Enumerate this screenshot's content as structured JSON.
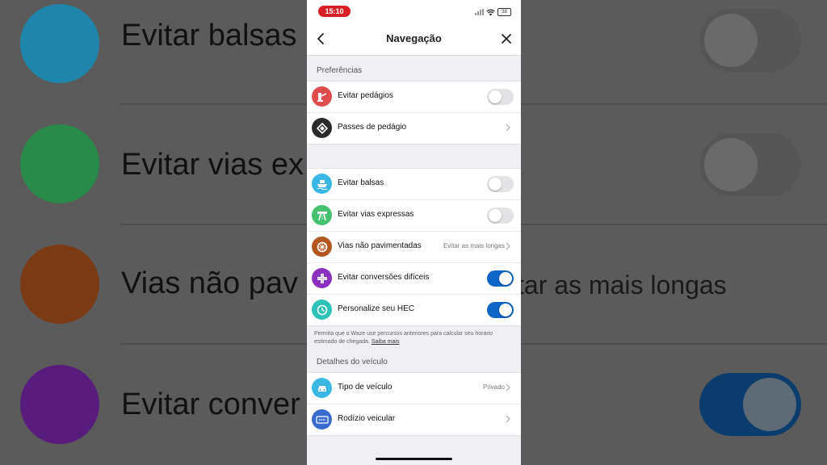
{
  "background": {
    "rows": [
      {
        "text": "Evitar balsas",
        "icon": "ferry-icon",
        "color": "#2bb3e0",
        "toggle": "off"
      },
      {
        "text": "Evitar vias ex",
        "icon": "highway-icon",
        "color": "#3dbf6a",
        "toggle": "off"
      },
      {
        "text": "Vias não pav",
        "icon": "wheel-icon",
        "color": "#b5501d",
        "value": "tar as mais longas"
      },
      {
        "text": "Evitar conver",
        "icon": "cross-icon",
        "color": "#7b2bb0",
        "toggle": "on"
      }
    ]
  },
  "status": {
    "time": "15:10",
    "battery": "38"
  },
  "nav": {
    "title": "Navegação"
  },
  "sections": {
    "preferences": "Preferências",
    "vehicle": "Detalhes do veículo"
  },
  "group1": [
    {
      "label": "Evitar pedágios",
      "icon": "toll-icon",
      "color": "#e04b4b",
      "toggle": "off"
    },
    {
      "label": "Passes de pedágio",
      "icon": "toll-pass-icon",
      "color": "#2a2a2a",
      "chevron": true
    }
  ],
  "group2": [
    {
      "label": "Evitar balsas",
      "icon": "ferry-icon",
      "color": "#39b8e6",
      "toggle": "off"
    },
    {
      "label": "Evitar vias expressas",
      "icon": "highway-icon",
      "color": "#45c26e",
      "toggle": "off"
    },
    {
      "label": "Vias não pavimentadas",
      "icon": "wheel-icon",
      "color": "#b4561f",
      "value": "Evitar as mais longas",
      "chevron": true
    },
    {
      "label": "Evitar conversões difíceis",
      "icon": "cross-icon",
      "color": "#8a2fc0",
      "toggle": "on"
    },
    {
      "label": "Personalize seu HEC",
      "icon": "clock-icon",
      "color": "#2fc2b8",
      "toggle": "on"
    }
  ],
  "footnote": {
    "text": "Permita que o Waze use percursos anteriores para calcular seu horário estimado de chegada. ",
    "link": "Saiba mais"
  },
  "group3": [
    {
      "label": "Tipo de veículo",
      "icon": "car-icon",
      "color": "#39b8e6",
      "value": "Privado",
      "chevron": true
    },
    {
      "label": "Rodízio veicular",
      "icon": "plate-icon",
      "color": "#3a6bd0",
      "chevron": true
    }
  ]
}
